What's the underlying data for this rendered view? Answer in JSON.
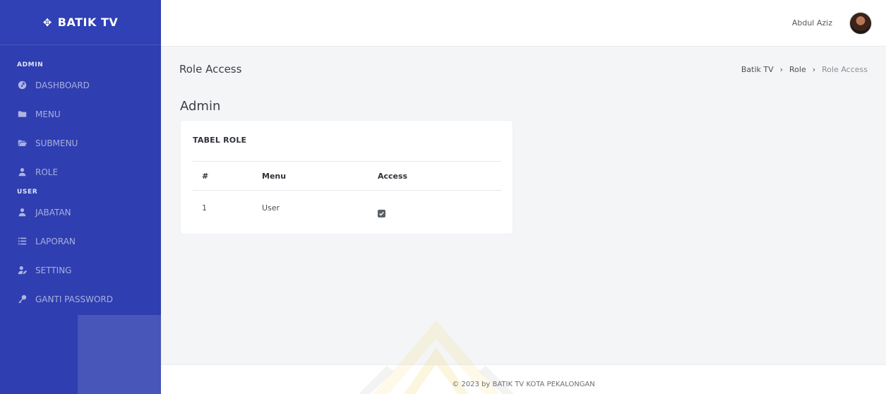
{
  "brand": {
    "name": "BATIK TV",
    "icon": "cross-arrows-icon"
  },
  "sidebar": {
    "sections": [
      {
        "label": "ADMIN",
        "items": [
          {
            "label": "DASHBOARD",
            "icon": "dashboard-icon"
          },
          {
            "label": "MENU",
            "icon": "folder-icon"
          },
          {
            "label": "SUBMENU",
            "icon": "folder-open-icon"
          },
          {
            "label": "ROLE",
            "icon": "user-icon"
          }
        ]
      },
      {
        "label": "USER",
        "items": [
          {
            "label": "JABATAN",
            "icon": "user-icon"
          },
          {
            "label": "LAPORAN",
            "icon": "list-icon"
          },
          {
            "label": "SETTING",
            "icon": "user-edit-icon"
          },
          {
            "label": "GANTI PASSWORD",
            "icon": "key-icon"
          }
        ]
      }
    ]
  },
  "topbar": {
    "user_name": "Abdul Aziz"
  },
  "page": {
    "title": "Role Access",
    "subtitle": "Admin",
    "breadcrumb": [
      "Batik TV",
      "Role",
      "Role Access"
    ]
  },
  "card": {
    "title": "TABEL ROLE",
    "columns": [
      "#",
      "Menu",
      "Access"
    ],
    "rows": [
      {
        "no": "1",
        "menu": "User",
        "access": true
      }
    ]
  },
  "footer": {
    "text": "© 2023 by BATIK TV KOTA PEKALONGAN"
  },
  "colors": {
    "sidebar": "#2f3eb0",
    "watermark": "#f2c21b"
  }
}
